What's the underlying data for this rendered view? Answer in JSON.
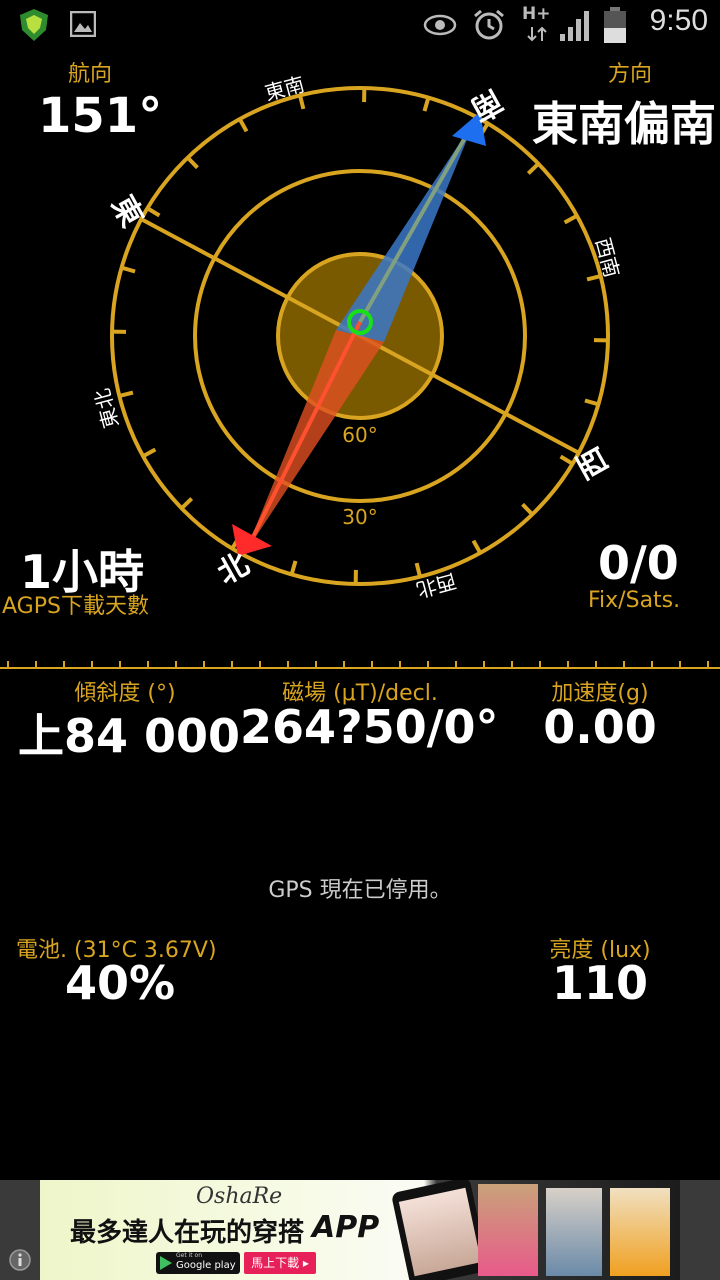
{
  "status_bar": {
    "time": "9:50",
    "network": "H+",
    "icons": [
      "app-shield-icon",
      "gallery-icon",
      "eye-icon",
      "alarm-icon",
      "network-hplus-icon",
      "signal-icon",
      "battery-icon"
    ]
  },
  "heading": {
    "label": "航向",
    "value": "151°"
  },
  "direction": {
    "label": "方向",
    "value": "東南偏南"
  },
  "compass": {
    "cardinal": {
      "south": "南",
      "east": "東",
      "west": "西",
      "north": "北"
    },
    "intercardinal": {
      "se": "東南",
      "sw": "西南",
      "ne": "東北",
      "nw": "西北"
    },
    "elevation_rings": [
      "60°",
      "30°"
    ],
    "colors": {
      "ring": "#d9a520",
      "inner_disc": "#7a5a00",
      "north_needle": "#ff4030",
      "south_needle": "#3070ff",
      "center_marker": "#18e018"
    }
  },
  "agps": {
    "value": "1小時",
    "label": "AGPS下載天數"
  },
  "fix": {
    "value": "0/0",
    "label": "Fix/Sats."
  },
  "tilt": {
    "label": "傾斜度 (°)",
    "value": "上84 000"
  },
  "magnetic": {
    "label": "磁場 (μT)/decl.",
    "value": "264?50/0°"
  },
  "accel": {
    "label": "加速度(g)",
    "value": "0.00"
  },
  "gps_status": "GPS 現在已停用。",
  "battery": {
    "label": "電池. (31°C 3.67V)",
    "value": "40%"
  },
  "brightness": {
    "label": "亮度 (lux)",
    "value": "110"
  },
  "ad": {
    "brand": "OshaRe",
    "headline": "最多達人在玩的穿搭",
    "headline_app": "APP",
    "google_play_small": "Get it on",
    "google_play": "Google play",
    "cta": "馬上下載 ▸"
  }
}
